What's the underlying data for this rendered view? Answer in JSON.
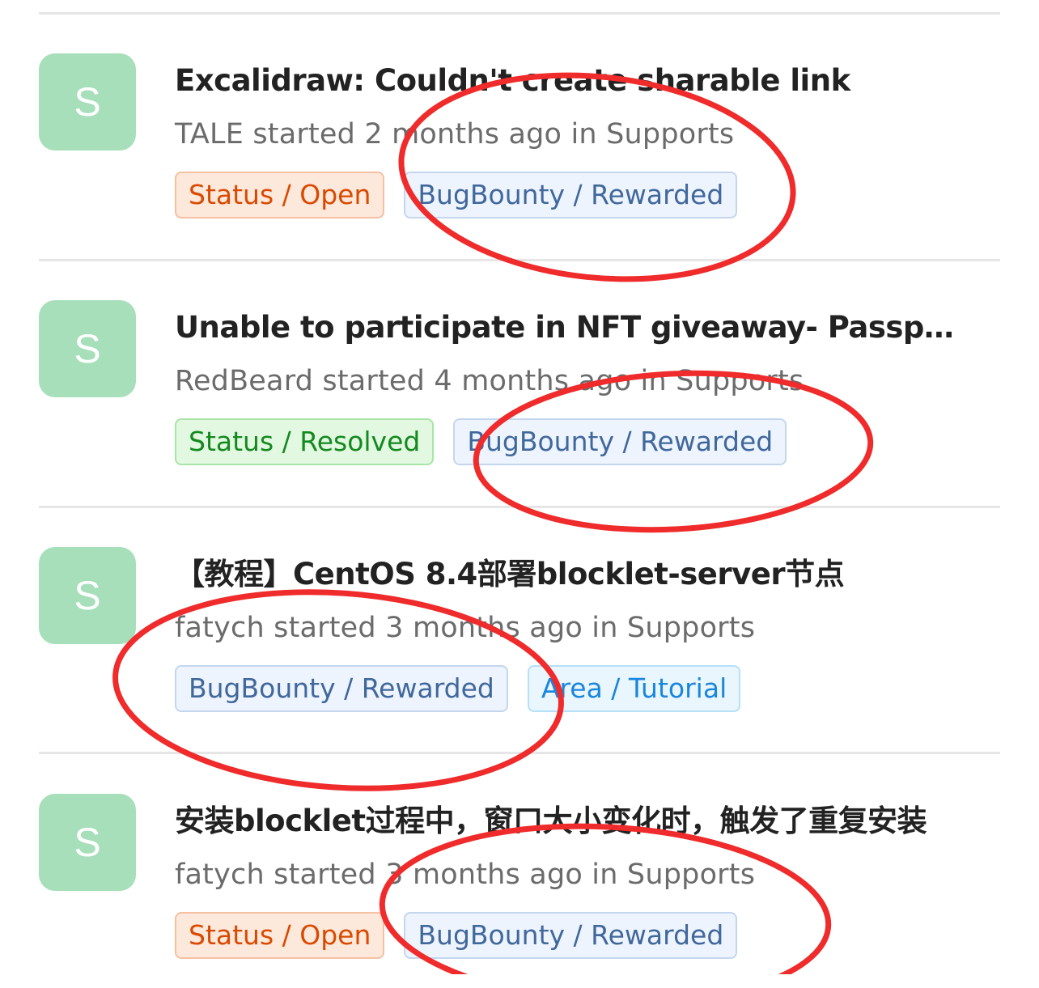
{
  "posts": [
    {
      "avatar_letter": "S",
      "title": "Excalidraw: Couldn't create sharable link",
      "meta": "TALE started 2 months ago in Supports",
      "tags": [
        {
          "label": "Status / Open",
          "color": "#d94a00"
        },
        {
          "label": "BugBounty / Rewarded",
          "color": "#40689c"
        }
      ]
    },
    {
      "avatar_letter": "S",
      "title": "Unable to participate in NFT giveaway- Passport",
      "meta": "RedBeard started 4 months ago in Supports",
      "tags": [
        {
          "label": "Status / Resolved",
          "color": "#138a1f"
        },
        {
          "label": "BugBounty / Rewarded",
          "color": "#40689c"
        }
      ]
    },
    {
      "avatar_letter": "S",
      "title": "【教程】CentOS 8.4部署blocklet-server节点",
      "meta": "fatych started 3 months ago in Supports",
      "tags": [
        {
          "label": "BugBounty / Rewarded",
          "color": "#40689c"
        },
        {
          "label": "Area / Tutorial",
          "color": "#1a86de"
        }
      ]
    },
    {
      "avatar_letter": "S",
      "title": "安装blocklet过程中，窗口大小变化时，触发了重复安装",
      "meta": "fatych started 3 months ago in Supports",
      "tags": [
        {
          "label": "Status / Open",
          "color": "#d94a00"
        },
        {
          "label": "BugBounty / Rewarded",
          "color": "#40689c"
        }
      ]
    }
  ],
  "annotation_color": "#ef2b2b"
}
